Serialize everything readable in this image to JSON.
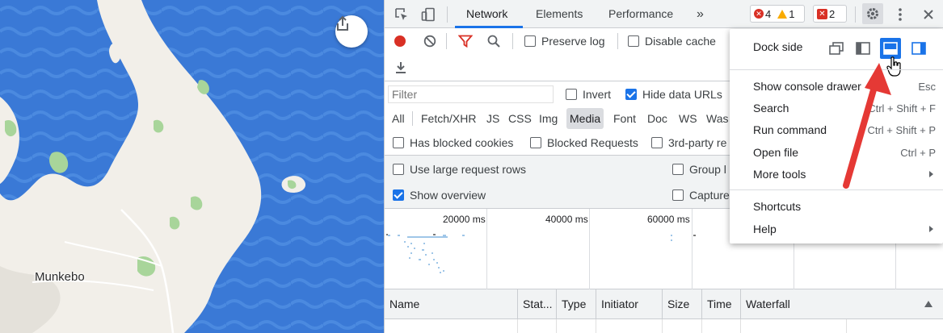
{
  "map": {
    "place_label": "Munkebo",
    "share_icon": "share-icon",
    "colors": {
      "water": "#3a79d6",
      "land": "#f2efe9",
      "park": "#a8d59a"
    }
  },
  "devtools": {
    "tabs": [
      "Network",
      "Elements",
      "Performance"
    ],
    "more_tabs_label": "»",
    "badges": {
      "errors": "4",
      "warnings": "1",
      "issues": "2"
    },
    "toolbar": {
      "preserve_log": "Preserve log",
      "disable_cache": "Disable cache"
    },
    "filter": {
      "placeholder": "Filter",
      "invert": "Invert",
      "hide_data_urls": "Hide data URLs",
      "types": [
        "All",
        "Fetch/XHR",
        "JS",
        "CSS",
        "Img",
        "Media",
        "Font",
        "Doc",
        "WS",
        "Was"
      ],
      "active_type": "Media",
      "has_blocked_cookies": "Has blocked cookies",
      "blocked_requests": "Blocked Requests",
      "third_party": "3rd-party re"
    },
    "settings": {
      "large_rows": "Use large request rows",
      "show_overview": "Show overview",
      "group": "Group l",
      "capture": "Capture"
    },
    "overview": {
      "ticks": [
        "20000 ms",
        "40000 ms",
        "60000 ms"
      ]
    },
    "table": {
      "columns": [
        "Name",
        "Stat...",
        "Type",
        "Initiator",
        "Size",
        "Time",
        "Waterfall"
      ]
    }
  },
  "menu": {
    "dock_side_label": "Dock side",
    "items": [
      {
        "label": "Show console drawer",
        "shortcut": "Esc"
      },
      {
        "label": "Search",
        "shortcut": "Ctrl + Shift + F"
      },
      {
        "label": "Run command",
        "shortcut": "Ctrl + Shift + P"
      },
      {
        "label": "Open file",
        "shortcut": "Ctrl + P"
      },
      {
        "label": "More tools",
        "shortcut": ""
      },
      {
        "label": "Shortcuts",
        "shortcut": ""
      },
      {
        "label": "Help",
        "shortcut": ""
      }
    ]
  },
  "colors": {
    "accent": "#1a73e8",
    "error": "#d93025",
    "warning": "#f9ab00",
    "arrow": "#e53935"
  }
}
